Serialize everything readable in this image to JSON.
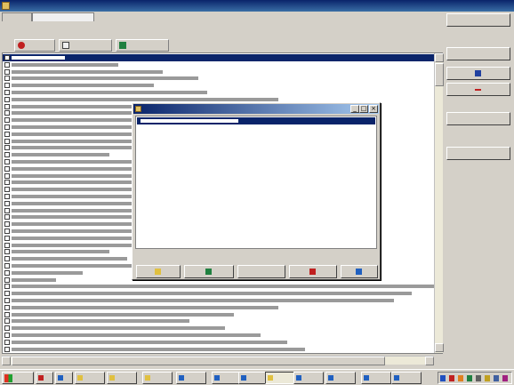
{
  "window": {
    "title": ""
  },
  "tabs": [
    {
      "label": "",
      "active": false
    },
    {
      "label": "",
      "active": true
    }
  ],
  "search_line": "",
  "toolbar": {
    "buttons": [
      {
        "label": "",
        "icon": "stop-icon"
      },
      {
        "label": "",
        "icon": "search-icon"
      },
      {
        "label": "",
        "icon": "transfer-icon"
      }
    ]
  },
  "list": {
    "selected_index": 0,
    "rows": [
      "",
      "",
      "",
      "",
      "",
      "",
      "",
      "",
      "",
      "",
      "",
      "",
      "",
      "",
      "",
      "",
      "",
      "",
      "",
      "",
      "",
      "",
      "",
      "",
      "",
      "",
      "",
      "",
      "",
      "",
      "",
      "",
      "",
      "",
      "",
      "",
      "",
      "",
      "",
      "",
      "",
      "",
      ""
    ]
  },
  "sidebar": {
    "buttons": [
      {
        "label": "",
        "icon": ""
      },
      {
        "label": "",
        "icon": ""
      },
      {
        "label": "",
        "icon": "view-icon"
      },
      {
        "label": "",
        "icon": "minus-icon"
      },
      {
        "label": "",
        "icon": ""
      },
      {
        "label": "",
        "icon": ""
      }
    ]
  },
  "dialog": {
    "title": "",
    "selected_item": "",
    "buttons": [
      {
        "label": "",
        "icon": "folder-icon"
      },
      {
        "label": "",
        "icon": "transfer-icon"
      },
      {
        "label": "",
        "icon": ""
      },
      {
        "label": "",
        "icon": "delete-icon"
      },
      {
        "label": "",
        "icon": "delete-all-icon"
      }
    ]
  },
  "taskbar": {
    "start_label": "",
    "tasks": [
      "",
      "",
      "",
      "",
      "",
      "",
      "",
      "",
      "",
      "",
      "",
      "",
      ""
    ],
    "active_task": 8
  },
  "colors": {
    "title_bar": "#0a246a",
    "selection": "#0a246a",
    "face": "#d4d0c8"
  }
}
